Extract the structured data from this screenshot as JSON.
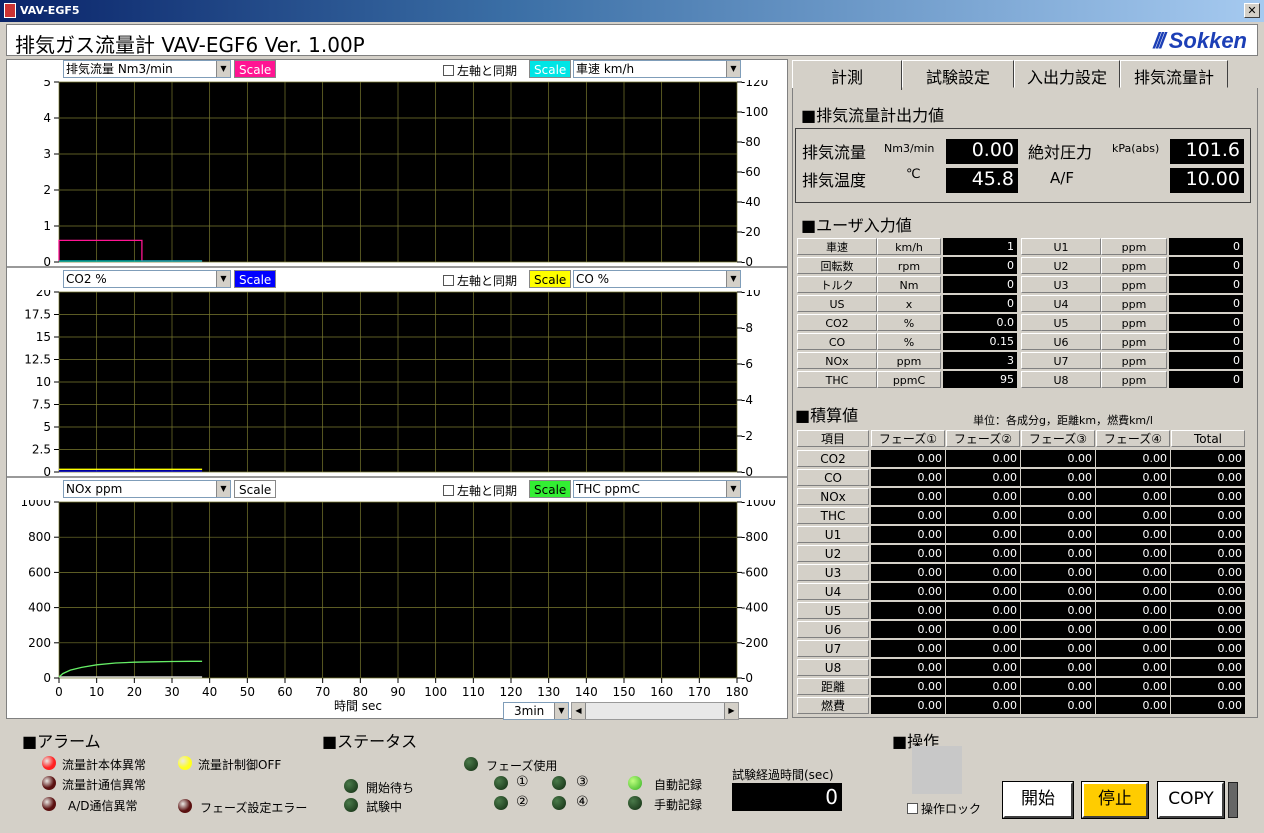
{
  "window": {
    "title": "VAV-EGF5",
    "close": "✕"
  },
  "header": {
    "title": "排気ガス流量計 VAV-EGF6  Ver. 1.00P",
    "logo": "Sokken"
  },
  "charts": [
    {
      "left_select": "排気流量 Nm3/min",
      "left_scale": "Scale",
      "left_color": "#ff1493",
      "sync": "左軸と同期",
      "right_scale": "Scale",
      "right_color": "#00e5e5",
      "right_select": "車速 km/h",
      "left_ticks": [
        "5",
        "4",
        "3",
        "2",
        "1",
        "0"
      ],
      "right_ticks": [
        "120",
        "100",
        "80",
        "60",
        "40",
        "20",
        "0"
      ]
    },
    {
      "left_select": "CO2 %",
      "left_scale": "Scale",
      "left_color": "#0000ff",
      "sync": "左軸と同期",
      "right_scale": "Scale",
      "right_color": "#ffff00",
      "right_select": "CO %",
      "left_ticks": [
        "20",
        "17.5",
        "15",
        "12.5",
        "10",
        "7.5",
        "5",
        "2.5",
        "0"
      ],
      "right_ticks": [
        "10",
        "8",
        "6",
        "4",
        "2",
        "0"
      ]
    },
    {
      "left_select": "NOx ppm",
      "left_scale": "Scale",
      "left_color": "#ffffff",
      "sync": "左軸と同期",
      "right_scale": "Scale",
      "right_color": "#33ee33",
      "right_select": "THC ppmC",
      "left_ticks": [
        "1000",
        "800",
        "600",
        "400",
        "200",
        "0"
      ],
      "right_ticks": [
        "1000",
        "800",
        "600",
        "400",
        "200",
        "0"
      ]
    }
  ],
  "x_axis": {
    "ticks": [
      "0",
      "10",
      "20",
      "30",
      "40",
      "50",
      "60",
      "70",
      "80",
      "90",
      "100",
      "110",
      "120",
      "130",
      "140",
      "150",
      "160",
      "170",
      "180"
    ],
    "label": "時間 sec",
    "range_select": "3min"
  },
  "chart_data": [
    {
      "type": "line",
      "xlim": [
        0,
        180
      ],
      "ylim": [
        0,
        5
      ],
      "y2lim": [
        0,
        120
      ],
      "series": [
        {
          "axis": "left",
          "color": "#ff1493",
          "x": [
            0,
            0,
            22,
            22,
            24,
            24,
            38
          ],
          "y": [
            0,
            0.6,
            0.6,
            0,
            0,
            0,
            0
          ]
        },
        {
          "axis": "right",
          "color": "#00cccc",
          "x": [
            0,
            38
          ],
          "y": [
            0,
            0
          ]
        }
      ]
    },
    {
      "type": "line",
      "xlim": [
        0,
        180
      ],
      "ylim": [
        0,
        20
      ],
      "y2lim": [
        0,
        10
      ],
      "series": [
        {
          "axis": "left",
          "color": "#0000ff",
          "x": [
            0,
            38
          ],
          "y": [
            0.05,
            0.05
          ]
        },
        {
          "axis": "right",
          "color": "#ffff00",
          "x": [
            0,
            38
          ],
          "y": [
            0.15,
            0.15
          ]
        }
      ]
    },
    {
      "type": "line",
      "xlim": [
        0,
        180
      ],
      "ylim": [
        0,
        1000
      ],
      "y2lim": [
        0,
        1000
      ],
      "series": [
        {
          "axis": "left",
          "color": "#ffffff",
          "x": [
            0,
            38
          ],
          "y": [
            3,
            3
          ]
        },
        {
          "axis": "right",
          "color": "#66ee66",
          "x": [
            0,
            1,
            3,
            6,
            10,
            15,
            20,
            25,
            30,
            35,
            38
          ],
          "y": [
            0,
            25,
            45,
            60,
            75,
            85,
            90,
            92,
            94,
            95,
            95
          ]
        }
      ]
    }
  ],
  "tabs": [
    "計測",
    "試験設定",
    "入出力設定",
    "排気流量計"
  ],
  "output": {
    "heading": "■排気流量計出力値",
    "flow_label": "排気流量",
    "flow_unit": "Nm3/min",
    "flow_value": "0.00",
    "pressure_label": "絶対圧力",
    "pressure_unit": "kPa(abs)",
    "pressure_value": "101.6",
    "temp_label": "排気温度",
    "temp_unit": "℃",
    "temp_value": "45.8",
    "af_label": "A/F",
    "af_value": "10.00"
  },
  "user_input": {
    "heading": "■ユーザ入力値",
    "left": [
      [
        "車速",
        "km/h",
        "1"
      ],
      [
        "回転数",
        "rpm",
        "0"
      ],
      [
        "トルク",
        "Nm",
        "0"
      ],
      [
        "US",
        "x",
        "0"
      ],
      [
        "CO2",
        "%",
        "0.0"
      ],
      [
        "CO",
        "%",
        "0.15"
      ],
      [
        "NOx",
        "ppm",
        "3"
      ],
      [
        "THC",
        "ppmC",
        "95"
      ]
    ],
    "right": [
      [
        "U1",
        "ppm",
        "0"
      ],
      [
        "U2",
        "ppm",
        "0"
      ],
      [
        "U3",
        "ppm",
        "0"
      ],
      [
        "U4",
        "ppm",
        "0"
      ],
      [
        "U5",
        "ppm",
        "0"
      ],
      [
        "U6",
        "ppm",
        "0"
      ],
      [
        "U7",
        "ppm",
        "0"
      ],
      [
        "U8",
        "ppm",
        "0"
      ]
    ]
  },
  "integrated": {
    "heading": "■積算値",
    "units": "単位：各成分g，距離km，燃費km/l",
    "headers": [
      "項目",
      "フェーズ①",
      "フェーズ②",
      "フェーズ③",
      "フェーズ④",
      "Total"
    ],
    "rows": [
      "CO2",
      "CO",
      "NOx",
      "THC",
      "U1",
      "U2",
      "U3",
      "U4",
      "U5",
      "U6",
      "U7",
      "U8",
      "距離",
      "燃費"
    ],
    "value": "0.00"
  },
  "alarm": {
    "heading": "■アラーム",
    "items": [
      {
        "label": "流量計本体異常",
        "color": "#ff2020"
      },
      {
        "label": "流量計制御OFF",
        "color": "#ffff20"
      },
      {
        "label": "流量計通信異常",
        "color": "#5a1010"
      },
      {
        "label": "A/D通信異常",
        "color": "#5a1010"
      },
      {
        "label": "フェーズ設定エラー",
        "color": "#5a1010"
      }
    ]
  },
  "status": {
    "heading": "■ステータス",
    "wait": "開始待ち",
    "testing": "試験中",
    "phase_use": "フェーズ使用",
    "phases": [
      "①",
      "②",
      "③",
      "④"
    ],
    "auto": "自動記録",
    "manual": "手動記録",
    "elapsed_label": "試験経過時間(sec)",
    "elapsed_value": "0"
  },
  "operation": {
    "heading": "■操作",
    "lock": "操作ロック",
    "start": "開始",
    "stop": "停止",
    "copy": "COPY"
  }
}
